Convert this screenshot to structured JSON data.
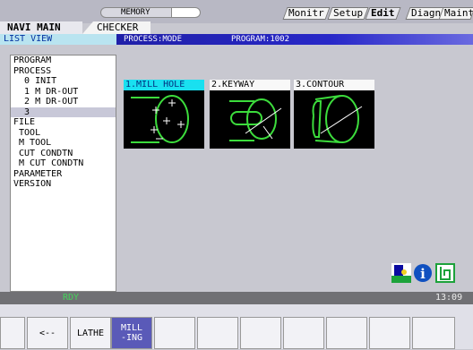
{
  "top": {
    "memory": "MEMORY",
    "tabs": [
      "Monitr",
      "Setup",
      "Edit",
      "Diagn",
      "Mainte"
    ],
    "active_tab": "Edit"
  },
  "nav": {
    "main": "NAVI MAIN",
    "checker": "CHECKER",
    "list_view": "LIST VIEW"
  },
  "header": {
    "mode": "PROCESS:MODE",
    "program": "PROGRAM:1002"
  },
  "tree": [
    "PROGRAM",
    "PROCESS",
    "  0 INIT",
    "  1 M DR-OUT",
    "  2 M DR-OUT",
    "  3",
    "FILE",
    " TOOL",
    " M TOOL",
    " CUT CONDTN",
    " M CUT CONDTN",
    "PARAMETER",
    "VERSION"
  ],
  "tree_selected_index": 5,
  "cards": [
    {
      "label": "1.MILL HOLE",
      "icon": "mill-hole-icon"
    },
    {
      "label": "2.KEYWAY",
      "icon": "keyway-icon"
    },
    {
      "label": "3.CONTOUR",
      "icon": "contour-icon"
    }
  ],
  "status": {
    "rdy": "RDY",
    "time": "13:09"
  },
  "softkeys": [
    "",
    "<--",
    "LATHE",
    "MILL\n-ING",
    "",
    "",
    "",
    "",
    "",
    "",
    ""
  ],
  "colors": {
    "accent": "#19e0f0",
    "header": "#2828c8",
    "rdy": "#45d45a"
  }
}
